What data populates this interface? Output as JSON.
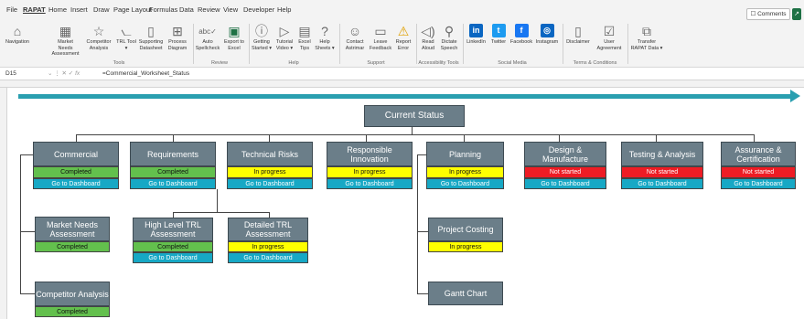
{
  "menu": {
    "file": "File",
    "rapat": "RAPAT",
    "home": "Home",
    "insert": "Insert",
    "draw": "Draw",
    "page_layout": "Page Layout",
    "formulas": "Formulas",
    "data": "Data",
    "review": "Review",
    "view": "View",
    "developer": "Developer",
    "help": "Help"
  },
  "comments_label": "Comments",
  "ribbon": {
    "navigation": "Navigation",
    "market_needs_assessment": "Market Needs Assessment",
    "competitor_analysis": "Competitor Analysis",
    "trl_tool": "TRL Tool ▾",
    "supporting_datasheet": "Supporting Datasheet",
    "process_diagram": "Process Diagram",
    "auto_spellcheck": "Auto Spellcheck",
    "export_to_excel": "Export to Excel",
    "getting_started": "Getting Started ▾",
    "tutorial_video": "Tutorial Video ▾",
    "excel_tips": "Excel Tips",
    "help_sheets": "Help Sheets ▾",
    "contact_astrimar": "Contact Astrimar",
    "leave_feedback": "Leave Feedback",
    "report_error": "Report Error",
    "read_aloud": "Read Aloud",
    "dictate_speech": "Dictate Speech",
    "linkedin": "LinkedIn",
    "twitter": "Twitter",
    "facebook": "Facebook",
    "instagram": "Instagram",
    "disclaimer": "Disclaimer",
    "user_agreement": "User Agreement",
    "transfer_rapat_data": "Transfer RAPAT Data ▾",
    "groups": {
      "tools": "Tools",
      "review": "Review",
      "help": "Help",
      "support": "Support",
      "accessibility": "Accessibility Tools",
      "social": "Social Media",
      "terms": "Terms & Conditions"
    }
  },
  "formula_bar": {
    "cell": "D15",
    "fx": "fx",
    "formula": "=Commercial_Worksheet_Status"
  },
  "icons": {
    "navigation": "house-icon",
    "market_needs": "grid-icon",
    "competitor": "star-icon",
    "trl": "chart-icon",
    "supporting": "document-icon",
    "process": "flow-icon",
    "spellcheck": "spellcheck-icon",
    "export": "excel-icon",
    "getting_started": "info-icon",
    "video": "play-icon",
    "tips": "excel-tips-icon",
    "help": "question-icon",
    "contact": "person-icon",
    "feedback": "speech-bubble-icon",
    "report": "warning-icon",
    "read": "speaker-icon",
    "dictate": "microphone-icon",
    "disclaimer": "document-icon",
    "agreement": "checkbox-icon",
    "transfer": "transfer-icon"
  },
  "colors": {
    "box": "#6b7e89",
    "completed": "#63c04d",
    "in_progress": "#ffff00",
    "not_started": "#ee1c24",
    "dashboard": "#17a8c5",
    "arrow": "#2a9fb0"
  },
  "diagram": {
    "root": "Current Status",
    "dash": "Go to Dashboard",
    "commercial": {
      "title": "Commercial",
      "status": "Completed"
    },
    "requirements": {
      "title": "Requirements",
      "status": "Completed"
    },
    "technical_risks": {
      "title": "Technical Risks",
      "status": "In progress"
    },
    "responsible_innovation": {
      "title": "Responsible Innovation",
      "status": "In progress"
    },
    "planning": {
      "title": "Planning",
      "status": "In progress"
    },
    "design_manufacture": {
      "title": "Design & Manufacture",
      "status": "Not started"
    },
    "testing_analysis": {
      "title": "Testing & Analysis",
      "status": "Not started"
    },
    "assurance_certification": {
      "title": "Assurance & Certification",
      "status": "Not started"
    },
    "market_needs": {
      "title": "Market Needs Assessment",
      "status": "Completed"
    },
    "competitor": {
      "title": "Competitor Analysis",
      "status": "Completed"
    },
    "high_level_trl": {
      "title": "High Level TRL Assessment",
      "status": "Completed"
    },
    "detailed_trl": {
      "title": "Detailed TRL Assessment",
      "status": "In progress"
    },
    "project_costing": {
      "title": "Project Costing",
      "status": "In progress"
    },
    "gantt": {
      "title": "Gantt Chart"
    }
  }
}
